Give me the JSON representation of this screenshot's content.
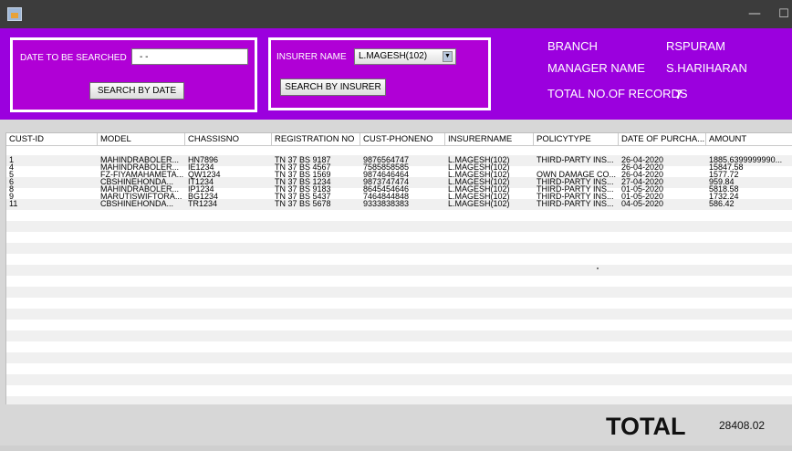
{
  "form": {
    "date_label": "DATE TO BE SEARCHED",
    "date_value": "- -",
    "search_date_button": "SEARCH BY DATE",
    "insurer_label": "INSURER NAME",
    "insurer_selected": "L.MAGESH(102)",
    "search_insurer_button": "SEARCH BY INSURER"
  },
  "info": {
    "branch_label": "BRANCH",
    "branch_value": "RSPURAM",
    "manager_label": "MANAGER NAME",
    "manager_value": "S.HARIHARAN",
    "total_records_label": "TOTAL NO.OF RECORDS",
    "total_records_value": "7"
  },
  "table": {
    "columns": [
      "CUST-ID",
      "MODEL",
      "CHASSISNO",
      "REGISTRATION NO",
      "CUST-PHONENO",
      "INSURERNAME",
      "POLICYTYPE",
      "DATE OF PURCHA...",
      "AMOUNT"
    ],
    "rows": [
      [
        "1",
        "MAHINDRABOLER...",
        "HN7896",
        "TN 37 BS 9187",
        "9876564747",
        "L.MAGESH(102)",
        "THIRD-PARTY INS...",
        "26-04-2020",
        "1885.6399999990..."
      ],
      [
        "4",
        "MAHINDRABOLER...",
        "IE1234",
        "TN 37 BS 4567",
        "7585858585",
        "L.MAGESH(102)",
        "",
        "26-04-2020",
        "15847.58"
      ],
      [
        "5",
        "FZ-FIYAMAHAMETA...",
        "QW1234",
        "TN 37 BS 1569",
        "9874646464",
        "L.MAGESH(102)",
        "OWN DAMAGE CO...",
        "26-04-2020",
        "1577.72"
      ],
      [
        "6",
        "CBSHINEHONDA...",
        "IT1234",
        "TN 37 BS 1234",
        "9873747474",
        "L.MAGESH(102)",
        "THIRD-PARTY INS...",
        "27-04-2020",
        "959.84"
      ],
      [
        "8",
        "MAHINDRABOLER...",
        "IP1234",
        "TN 37 BS 9183",
        "8645454646",
        "L.MAGESH(102)",
        "THIRD-PARTY INS...",
        "01-05-2020",
        "5818.58"
      ],
      [
        "9",
        "MARUTISWIFTORA...",
        "BG1234",
        "TN 37 BS 5437",
        "7464844848",
        "L.MAGESH(102)",
        "THIRD-PARTY INS...",
        "01-05-2020",
        "1732.24"
      ],
      [
        "11",
        "CBSHINEHONDA...",
        "TR1234",
        "TN 37 BS 5678",
        "9333838383",
        "L.MAGESH(102)",
        "THIRD-PARTY INS...",
        "04-05-2020",
        "586.42"
      ]
    ]
  },
  "footer": {
    "total_label": "TOTAL",
    "total_value": "28408.02"
  },
  "colors": {
    "header_bg": "#9b00de",
    "group_bg": "#b000d6",
    "titlebar_bg": "#3c3c3c"
  }
}
